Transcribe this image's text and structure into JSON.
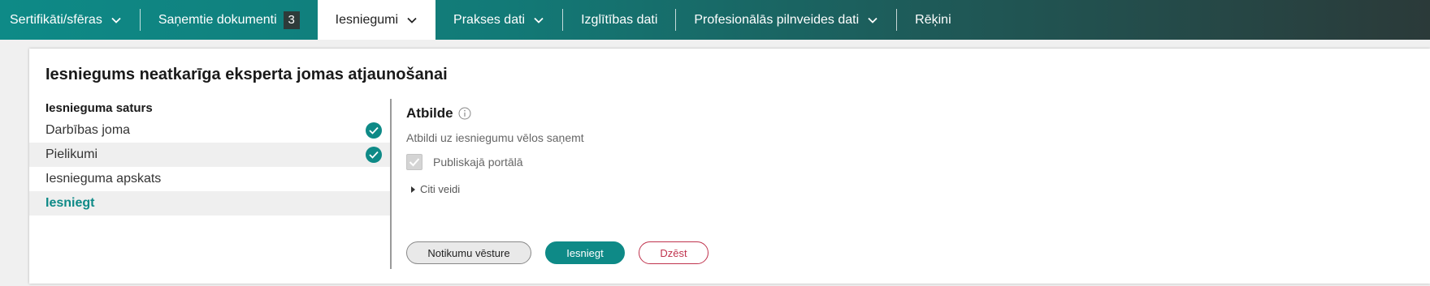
{
  "nav": {
    "items": [
      {
        "label": "Sertifikāti/sfēras",
        "chevron": true
      },
      {
        "label": "Saņemtie dokumenti",
        "badge": "3"
      },
      {
        "label": "Iesniegumi",
        "chevron": true,
        "active": true
      },
      {
        "label": "Prakses dati",
        "chevron": true
      },
      {
        "label": "Izglītības dati"
      },
      {
        "label": "Profesionālās pilnveides dati",
        "chevron": true
      },
      {
        "label": "Rēķini"
      }
    ]
  },
  "page": {
    "title": "Iesniegums neatkarīga eksperta jomas atjaunošanai"
  },
  "sidebar": {
    "heading": "Iesnieguma saturs",
    "items": [
      {
        "label": "Darbības joma",
        "done": true
      },
      {
        "label": "Pielikumi",
        "done": true
      },
      {
        "label": "Iesnieguma apskats",
        "done": false
      },
      {
        "label": "Iesniegt",
        "done": false,
        "current": true
      }
    ]
  },
  "answer": {
    "title": "Atbilde",
    "subtitle": "Atbildi uz iesniegumu vēlos saņemt",
    "checkbox_label": "Publiskajā portālā",
    "checkbox_checked": true,
    "other_ways": "Citi veidi"
  },
  "buttons": {
    "history": "Notikumu vēsture",
    "submit": "Iesniegt",
    "delete": "Dzēst"
  },
  "colors": {
    "accent": "#0e8a87",
    "danger": "#c0334d"
  }
}
